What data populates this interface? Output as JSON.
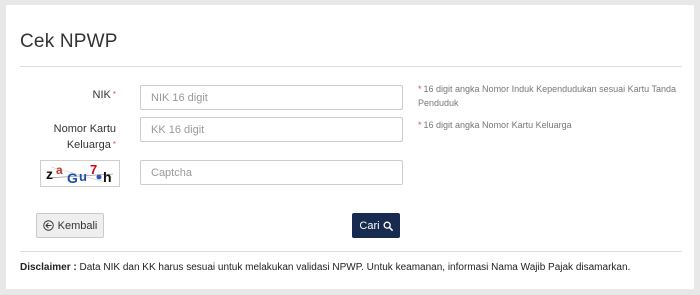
{
  "page": {
    "title": "Cek NPWP"
  },
  "form": {
    "nik": {
      "label": "NIK",
      "required_mark": "*",
      "placeholder": "NIK 16 digit",
      "value": "",
      "hint_star": "*",
      "hint": "16 digit angka Nomor Induk Kependudukan sesuai Kartu Tanda Penduduk"
    },
    "kk": {
      "label_line1": "Nomor Kartu",
      "label_line2": "Keluarga",
      "required_mark": "*",
      "placeholder": "KK 16 digit",
      "value": "",
      "hint_star": "*",
      "hint": "16 digit angka Nomor Kartu Keluarga"
    },
    "captcha": {
      "image_text": "zaGu7h",
      "placeholder": "Captcha",
      "value": ""
    }
  },
  "buttons": {
    "back_label": "Kembali",
    "back_icon": "arrow-circle-left-icon",
    "search_label": "Cari",
    "search_icon": "search-icon",
    "search_color": "#172a4f"
  },
  "disclaimer": {
    "heading": "Disclaimer :",
    "text": "Data NIK dan KK harus sesuai untuk melakukan validasi NPWP. Untuk keamanan, informasi Nama Wajib Pajak disamarkan."
  }
}
